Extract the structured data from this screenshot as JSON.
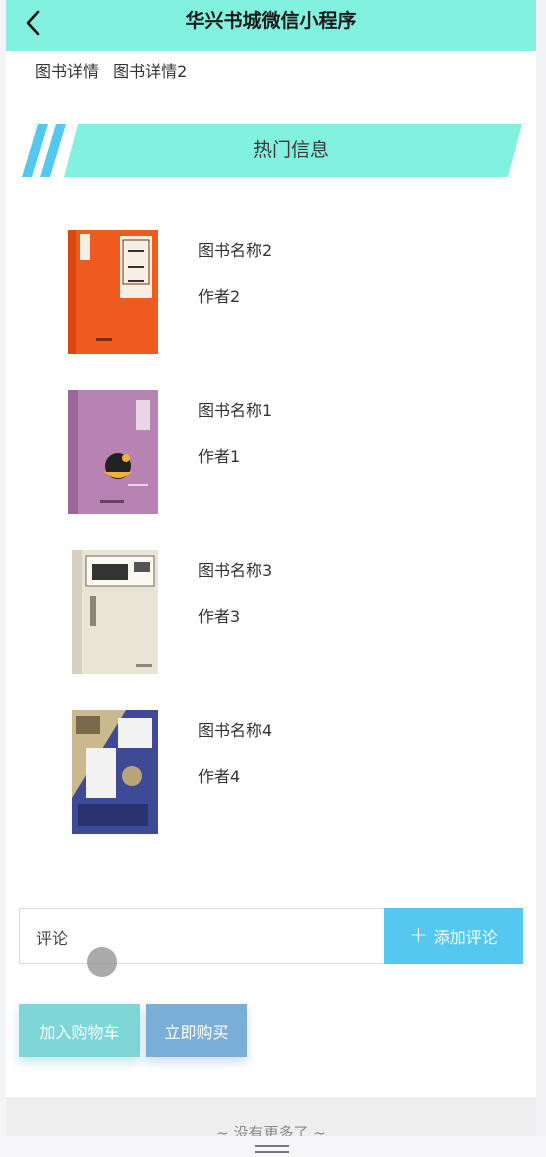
{
  "navbar": {
    "title": "华兴书城微信小程序",
    "back_icon": "chevron-left-icon",
    "background": "#82f1e0"
  },
  "tabs": [
    {
      "label": "图书详情"
    },
    {
      "label": "图书详情2"
    }
  ],
  "section": {
    "title": "热门信息",
    "banner_color": "#82f1e0",
    "stripe_color": "#55c8f0"
  },
  "books": [
    {
      "name": "图书名称2",
      "author": "作者2",
      "cover": "book-cover-orange"
    },
    {
      "name": "图书名称1",
      "author": "作者1",
      "cover": "book-cover-purple"
    },
    {
      "name": "图书名称3",
      "author": "作者3",
      "cover": "book-cover-beige"
    },
    {
      "name": "图书名称4",
      "author": "作者4",
      "cover": "book-cover-blue"
    }
  ],
  "comment": {
    "value": "评论",
    "button_label": "添加评论",
    "button_icon": "plus-icon"
  },
  "actions": {
    "add_to_cart": "加入购物车",
    "buy_now": "立即购买"
  },
  "footer": {
    "no_more": "~ 没有更多了 ~"
  }
}
